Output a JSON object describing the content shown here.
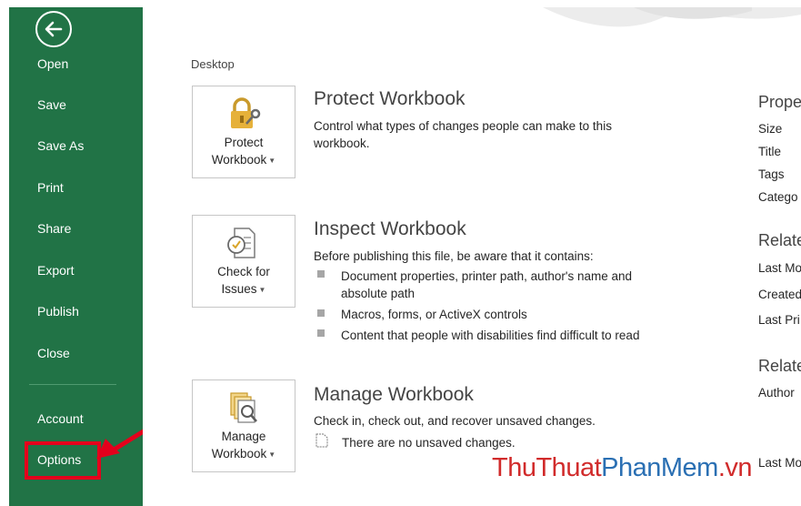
{
  "sidebar": {
    "nav": {
      "open": "Open",
      "save": "Save",
      "save_as": "Save As",
      "print": "Print",
      "share": "Share",
      "export": "Export",
      "publish": "Publish",
      "close": "Close",
      "account": "Account",
      "options": "Options"
    },
    "highlighted_item": "Options"
  },
  "main": {
    "location": "Desktop",
    "sections": {
      "protect": {
        "tile_line1": "Protect",
        "tile_line2": "Workbook",
        "title": "Protect Workbook",
        "description": "Control what types of changes people can make to this workbook."
      },
      "inspect": {
        "tile_line1": "Check for",
        "tile_line2": "Issues",
        "title": "Inspect Workbook",
        "description": "Before publishing this file, be aware that it contains:",
        "bullets": [
          "Document properties, printer path, author's name and absolute path",
          "Macros, forms, or ActiveX controls",
          "Content that people with disabilities find difficult to read"
        ]
      },
      "manage": {
        "tile_line1": "Manage",
        "tile_line2": "Workbook",
        "title": "Manage Workbook",
        "description": "Check in, check out, and recover unsaved changes.",
        "note": "There are no unsaved changes."
      }
    }
  },
  "properties_panel": {
    "heading1": "Prope",
    "items1": [
      "Size",
      "Title",
      "Tags",
      "Catego"
    ],
    "heading2": "Relate",
    "items2": [
      "Last Mo",
      "Created",
      "Last Pri"
    ],
    "heading3": "Relate",
    "items3": [
      "Author"
    ],
    "item_bottom": "Last Mo"
  },
  "watermark": {
    "part1": "ThuThuat",
    "part2": "PhanMem",
    "part3": ".vn"
  },
  "colors": {
    "sidebar_bg": "#217346",
    "highlight_red": "#e4001c",
    "accent_gold": "#d9a52a"
  }
}
